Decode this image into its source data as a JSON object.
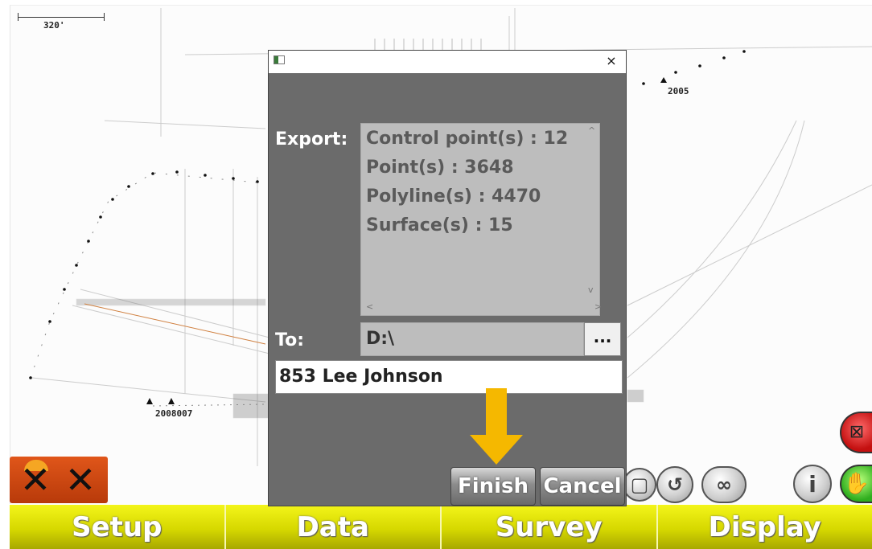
{
  "map": {
    "scale_label": "320'",
    "point_labels": [
      "2005",
      "2008007"
    ]
  },
  "dialog": {
    "export_label": "Export:",
    "summary": [
      "Control point(s) : 12",
      "Point(s) : 3648",
      "Polyline(s) : 4470",
      "Surface(s) : 15"
    ],
    "to_label": "To:",
    "path_value": "D:\\",
    "browse_label": "...",
    "filename_value": "853 Lee Johnson",
    "finish_label": "Finish",
    "cancel_label": "Cancel",
    "close_glyph": "×"
  },
  "tabs": [
    "Setup",
    "Data",
    "Survey",
    "Display"
  ],
  "colors": {
    "dialog_bg": "#6b6b6b",
    "tab_yellow": "#d6d800",
    "highlight_arrow": "#f5b800"
  },
  "icons": [
    "app-window-icon",
    "close-icon",
    "gnss-disconnected-icon",
    "zoom-extent-icon",
    "rotate-icon",
    "infinity-icon",
    "info-icon",
    "pan-hand-icon",
    "no-connection-icon"
  ]
}
